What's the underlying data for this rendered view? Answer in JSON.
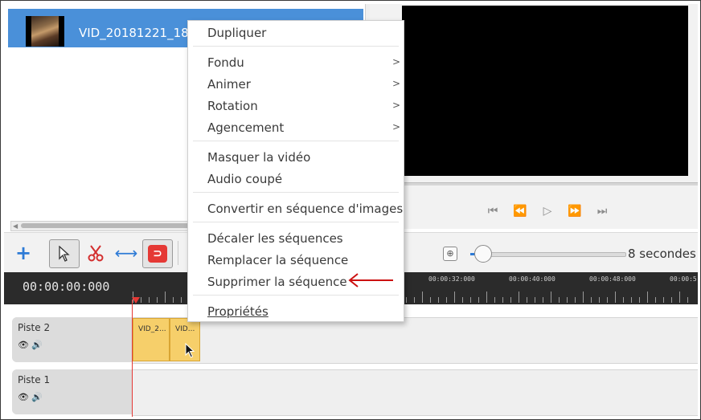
{
  "library": {
    "clip_name": "VID_20181221_1821"
  },
  "viewer": {
    "controls": [
      "⏮",
      "⏪",
      "▷",
      "⏩",
      "⏭"
    ]
  },
  "toolbar": {
    "add_symbol": "+",
    "zoom_label": "8 secondes"
  },
  "ruler": {
    "timecode": "00:00:00:000",
    "ticks": [
      "00:00:32:000",
      "00:00:40:000",
      "00:00:48:000",
      "00:00:5"
    ]
  },
  "tracks": [
    {
      "name": "Piste 2",
      "icons": "👁🔊",
      "clips": [
        "VID_2...",
        "VID..."
      ]
    },
    {
      "name": "Piste 1",
      "icons": "👁🔊",
      "clips": []
    }
  ],
  "context_menu": {
    "items": [
      {
        "label": "Dupliquer"
      },
      {
        "label": "Fondu",
        "submenu": ">"
      },
      {
        "label": "Animer",
        "submenu": ">"
      },
      {
        "label": "Rotation",
        "submenu": ">"
      },
      {
        "label": "Agencement",
        "submenu": ">"
      },
      {
        "label": "Masquer la vidéo"
      },
      {
        "label": "Audio coupé"
      },
      {
        "label": "Convertir en séquence d'images"
      },
      {
        "label": "Décaler les séquences"
      },
      {
        "label": "Remplacer la séquence"
      },
      {
        "label": "Supprimer la séquence"
      },
      {
        "label": "Propriétés"
      }
    ]
  },
  "colors": {
    "selection": "#4a90d9",
    "clip": "#f6cf6a",
    "playhead": "#e53935",
    "annotation_arrow": "#cc1111"
  }
}
